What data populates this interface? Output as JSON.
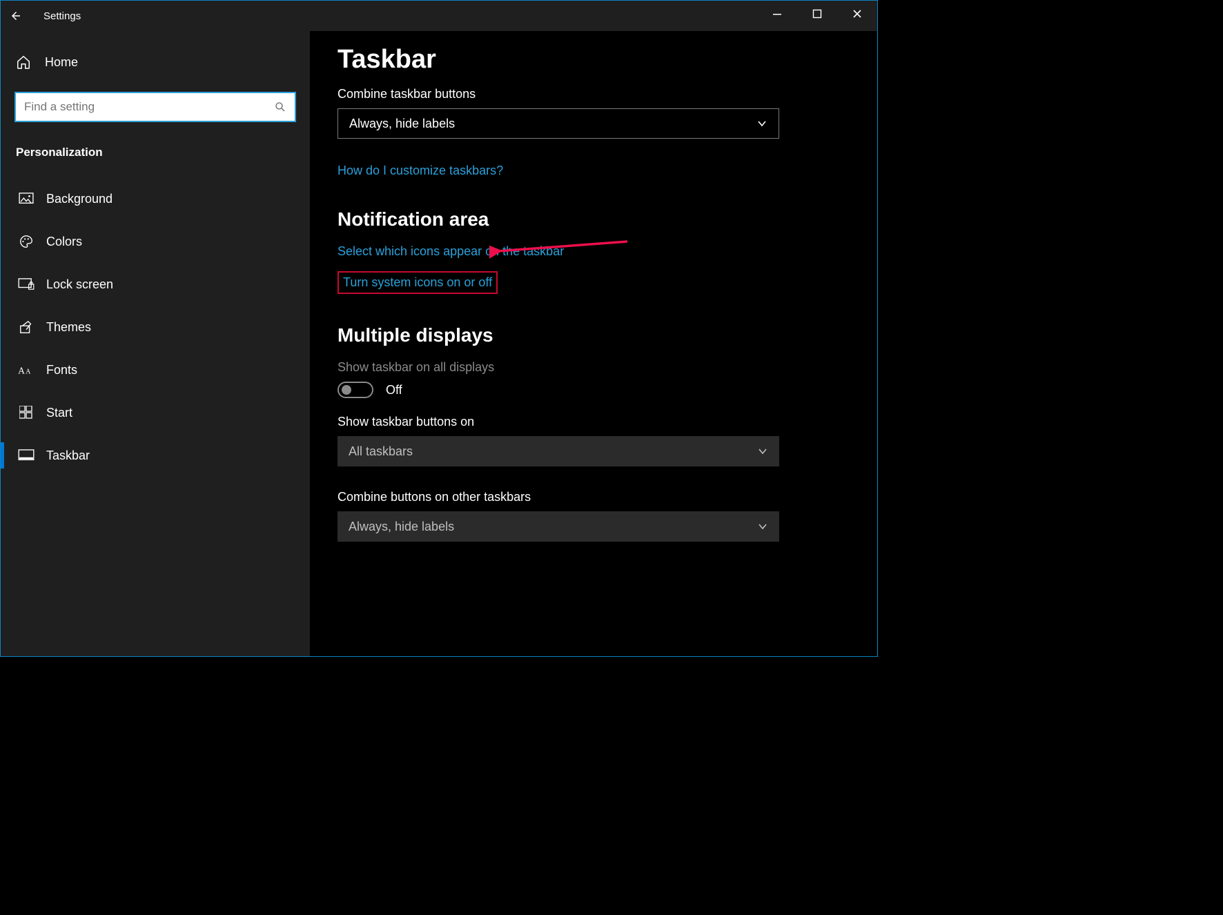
{
  "titlebar": {
    "app": "Settings"
  },
  "sidebar": {
    "home": "Home",
    "search_placeholder": "Find a setting",
    "section": "Personalization",
    "items": [
      {
        "label": "Background"
      },
      {
        "label": "Colors"
      },
      {
        "label": "Lock screen"
      },
      {
        "label": "Themes"
      },
      {
        "label": "Fonts"
      },
      {
        "label": "Start"
      },
      {
        "label": "Taskbar"
      }
    ],
    "selected_index": 6
  },
  "content": {
    "title": "Taskbar",
    "combine_label": "Combine taskbar buttons",
    "combine_value": "Always, hide labels",
    "help_link": "How do I customize taskbars?",
    "notif_heading": "Notification area",
    "notif_link1": "Select which icons appear on the taskbar",
    "notif_link2": "Turn system icons on or off",
    "multi_heading": "Multiple displays",
    "show_all_label": "Show taskbar on all displays",
    "show_all_state": "Off",
    "show_buttons_label": "Show taskbar buttons on",
    "show_buttons_value": "All taskbars",
    "combine_other_label": "Combine buttons on other taskbars",
    "combine_other_value": "Always, hide labels"
  }
}
